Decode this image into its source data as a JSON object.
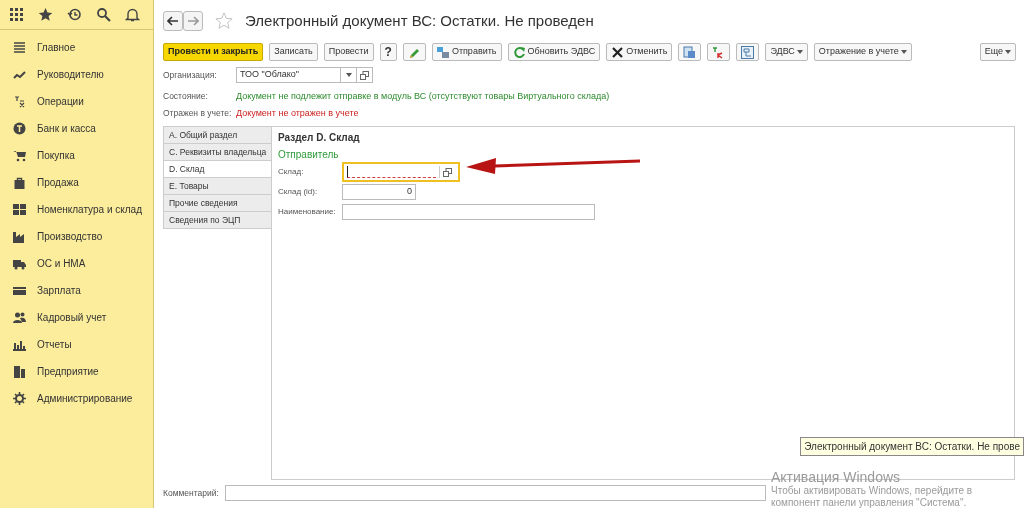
{
  "sidebar": {
    "items": [
      {
        "label": "Главное"
      },
      {
        "label": "Руководителю"
      },
      {
        "label": "Операции"
      },
      {
        "label": "Банк и касса"
      },
      {
        "label": "Покупка"
      },
      {
        "label": "Продажа"
      },
      {
        "label": "Номенклатура и склад"
      },
      {
        "label": "Производство"
      },
      {
        "label": "ОС и НМА"
      },
      {
        "label": "Зарплата"
      },
      {
        "label": "Кадровый учет"
      },
      {
        "label": "Отчеты"
      },
      {
        "label": "Предприятие"
      },
      {
        "label": "Администрирование"
      }
    ]
  },
  "window": {
    "title": "Электронный документ ВС: Остатки. Не проведен"
  },
  "toolbar": [
    {
      "kind": "primary",
      "label": "Провести и закрыть"
    },
    {
      "kind": "plain",
      "label": "Записать"
    },
    {
      "kind": "plain",
      "label": "Провести"
    },
    {
      "kind": "plain",
      "label": "?"
    },
    {
      "kind": "icon"
    },
    {
      "kind": "icon",
      "label": "Отправить"
    },
    {
      "kind": "icon",
      "label": "Обновить ЭДВС"
    },
    {
      "kind": "icon",
      "label": "Отменить"
    },
    {
      "kind": "icon"
    },
    {
      "kind": "icon"
    },
    {
      "kind": "icon"
    },
    {
      "kind": "dropdown",
      "label": "ЭДВС"
    },
    {
      "kind": "dropdown",
      "label": "Отражение в учете"
    },
    {
      "kind": "dropdown",
      "label": "Еще"
    }
  ],
  "organization": {
    "label": "Организация:",
    "value": "ТОО \"Облако\""
  },
  "status_rows": [
    {
      "label": "Состояние:",
      "value": "Документ не подлежит отправке в модуль ВС (отсутствуют товары Виртуального склада)",
      "kind": "info"
    },
    {
      "label": "Отражен в учете:",
      "value": "Документ не отражен в учете",
      "kind": "error"
    }
  ],
  "tabs": [
    {
      "label": "А. Общий раздел",
      "selected": false
    },
    {
      "label": "С. Реквизиты владельца",
      "selected": false
    },
    {
      "label": "D. Склад",
      "selected": true
    },
    {
      "label": "Е. Товары",
      "selected": false
    },
    {
      "label": "Прочие сведения",
      "selected": false
    },
    {
      "label": "Сведения по ЭЦП",
      "selected": false
    }
  ],
  "section": {
    "title": "Раздел D. Склад",
    "subtitle": "Отправитель",
    "fields": [
      {
        "label": "Склад:",
        "focused": true,
        "kind": "select"
      },
      {
        "label": "Склад (id):",
        "value": "0",
        "focused": false,
        "kind": "number"
      },
      {
        "label": "Наименование:",
        "focused": false,
        "kind": "text"
      }
    ]
  },
  "comment": {
    "label": "Комментарий:"
  },
  "tooltip": "Электронный документ ВС: Остатки. Не прове",
  "activation": {
    "title": "Активация Windows",
    "lines": [
      "Чтобы активировать Windows, перейдите в",
      "компонент панели управления \"Система\"."
    ]
  }
}
